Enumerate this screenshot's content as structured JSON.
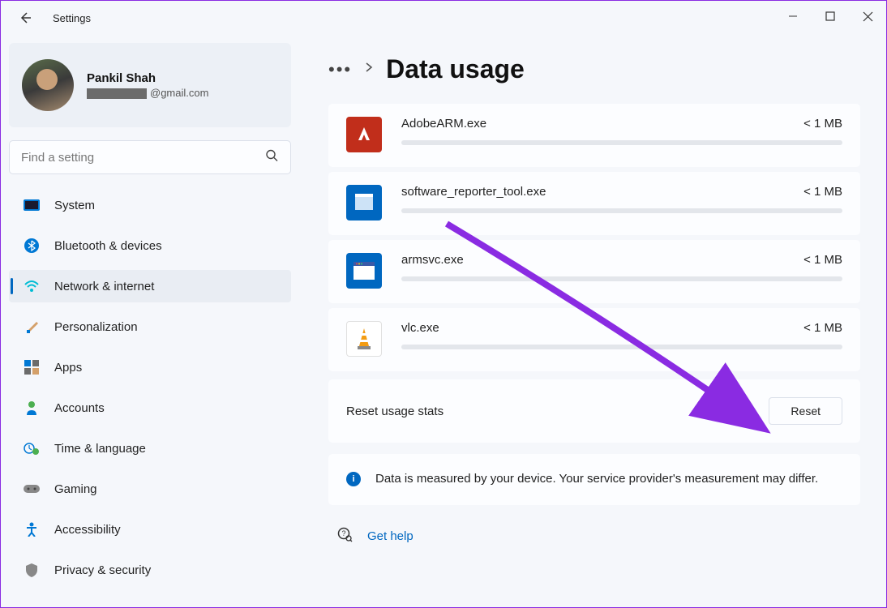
{
  "app_title": "Settings",
  "profile": {
    "name": "Pankil Shah",
    "email_suffix": "@gmail.com"
  },
  "search": {
    "placeholder": "Find a setting"
  },
  "sidebar": {
    "items": [
      {
        "label": "System"
      },
      {
        "label": "Bluetooth & devices"
      },
      {
        "label": "Network & internet"
      },
      {
        "label": "Personalization"
      },
      {
        "label": "Apps"
      },
      {
        "label": "Accounts"
      },
      {
        "label": "Time & language"
      },
      {
        "label": "Gaming"
      },
      {
        "label": "Accessibility"
      },
      {
        "label": "Privacy & security"
      }
    ]
  },
  "page": {
    "title": "Data usage",
    "apps": [
      {
        "name": "AdobeARM.exe",
        "size": "< 1 MB"
      },
      {
        "name": "software_reporter_tool.exe",
        "size": "< 1 MB"
      },
      {
        "name": "armsvc.exe",
        "size": "< 1 MB"
      },
      {
        "name": "vlc.exe",
        "size": "< 1 MB"
      }
    ],
    "reset_label": "Reset usage stats",
    "reset_button": "Reset",
    "info_text": "Data is measured by your device. Your service provider's measurement may differ.",
    "help_label": "Get help"
  }
}
